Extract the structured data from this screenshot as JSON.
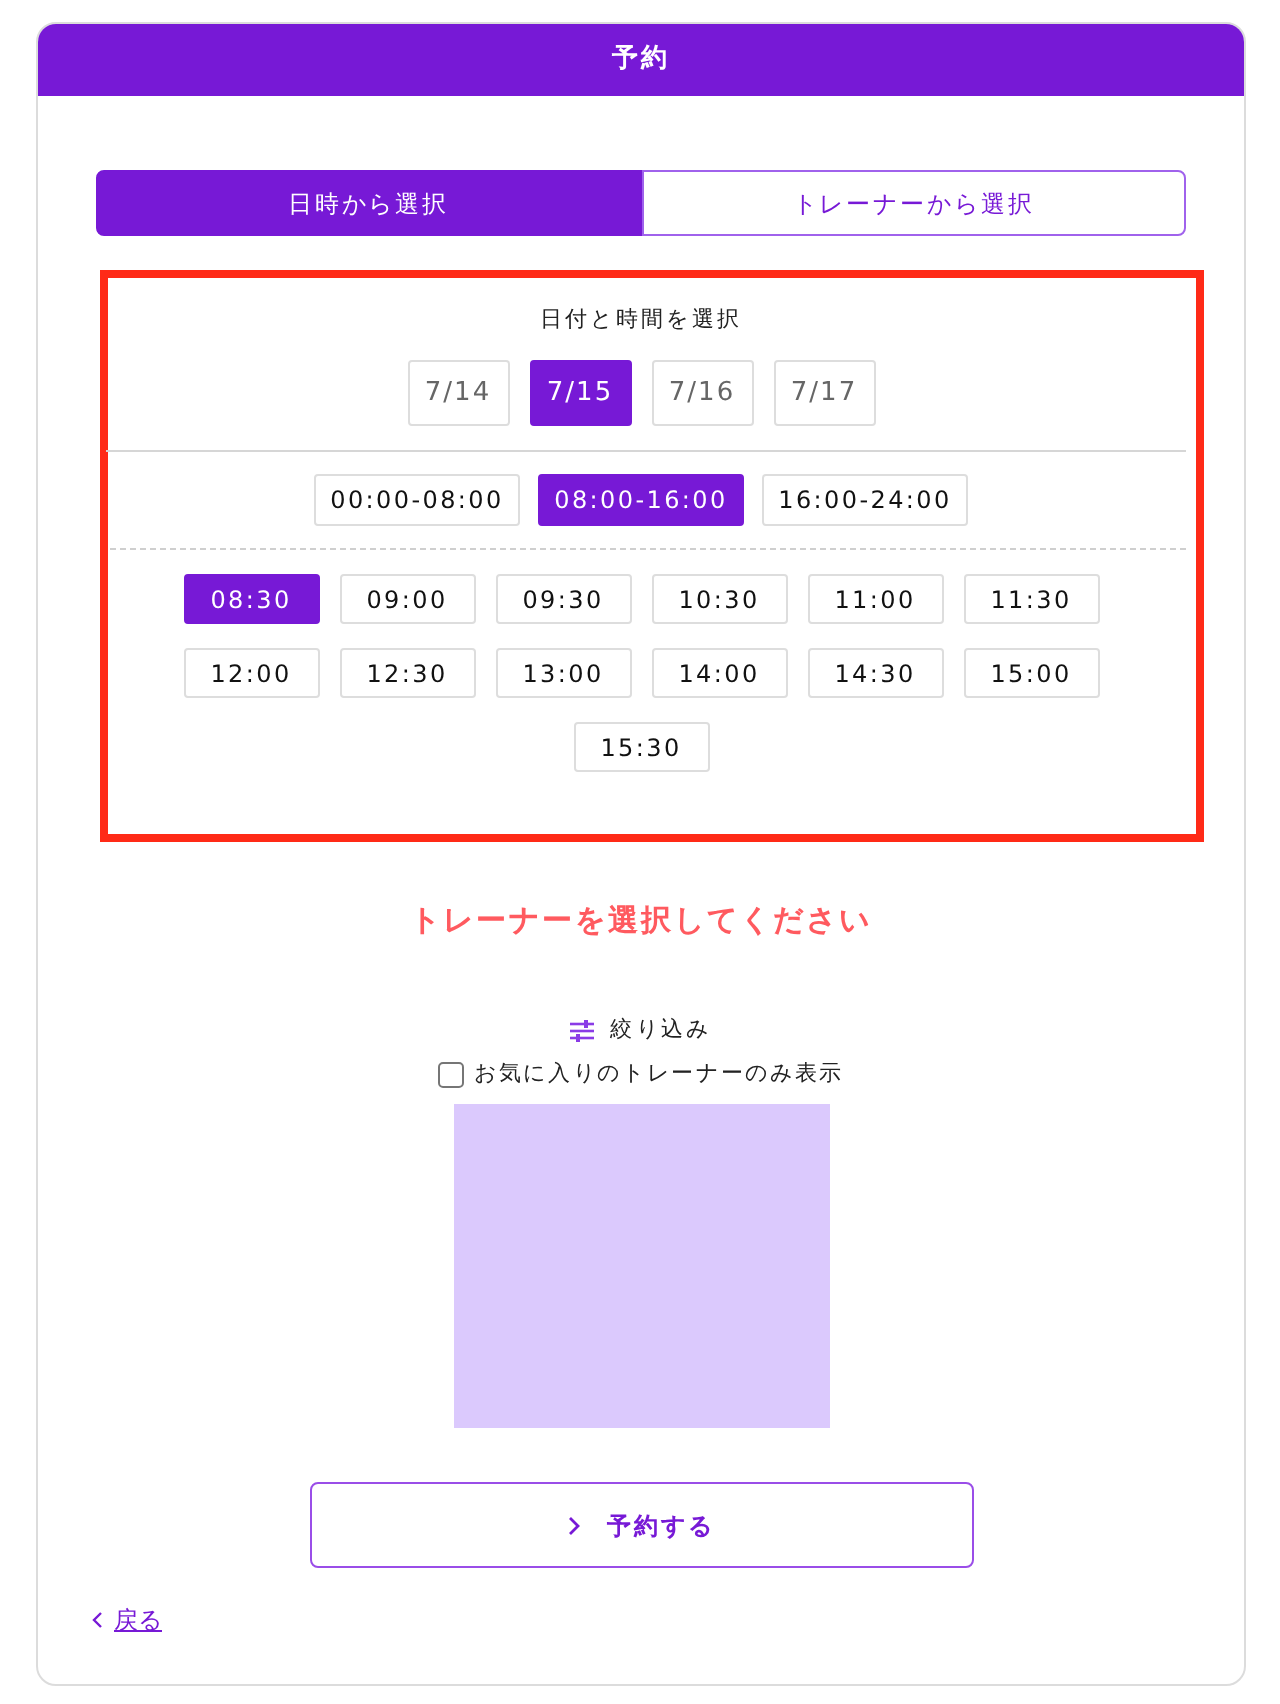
{
  "header": {
    "title": "予約"
  },
  "tabs": [
    {
      "label": "日時から選択",
      "selected": true
    },
    {
      "label": "トレーナーから選択",
      "selected": false
    }
  ],
  "date_time_picker": {
    "highlighted": true,
    "heading": "日付と時間を選択",
    "dates": [
      {
        "label": "7/14",
        "selected": false
      },
      {
        "label": "7/15",
        "selected": true
      },
      {
        "label": "7/16",
        "selected": false
      },
      {
        "label": "7/17",
        "selected": false
      }
    ],
    "time_ranges": [
      {
        "label": "00:00-08:00",
        "selected": false
      },
      {
        "label": "08:00-16:00",
        "selected": true
      },
      {
        "label": "16:00-24:00",
        "selected": false
      }
    ],
    "time_slots": [
      {
        "label": "08:30",
        "selected": true
      },
      {
        "label": "09:00",
        "selected": false
      },
      {
        "label": "09:30",
        "selected": false
      },
      {
        "label": "10:30",
        "selected": false
      },
      {
        "label": "11:00",
        "selected": false
      },
      {
        "label": "11:30",
        "selected": false
      },
      {
        "label": "12:00",
        "selected": false
      },
      {
        "label": "12:30",
        "selected": false
      },
      {
        "label": "13:00",
        "selected": false
      },
      {
        "label": "14:00",
        "selected": false
      },
      {
        "label": "14:30",
        "selected": false
      },
      {
        "label": "15:00",
        "selected": false
      },
      {
        "label": "15:30",
        "selected": false
      }
    ]
  },
  "message": "トレーナーを選択してください",
  "filter": {
    "label": "絞り込み",
    "favorites_only": {
      "label": "お気に入りのトレーナーのみ表示",
      "checked": false
    }
  },
  "submit_button": {
    "label": "予約する"
  },
  "back_link": {
    "label": "戻る"
  }
}
